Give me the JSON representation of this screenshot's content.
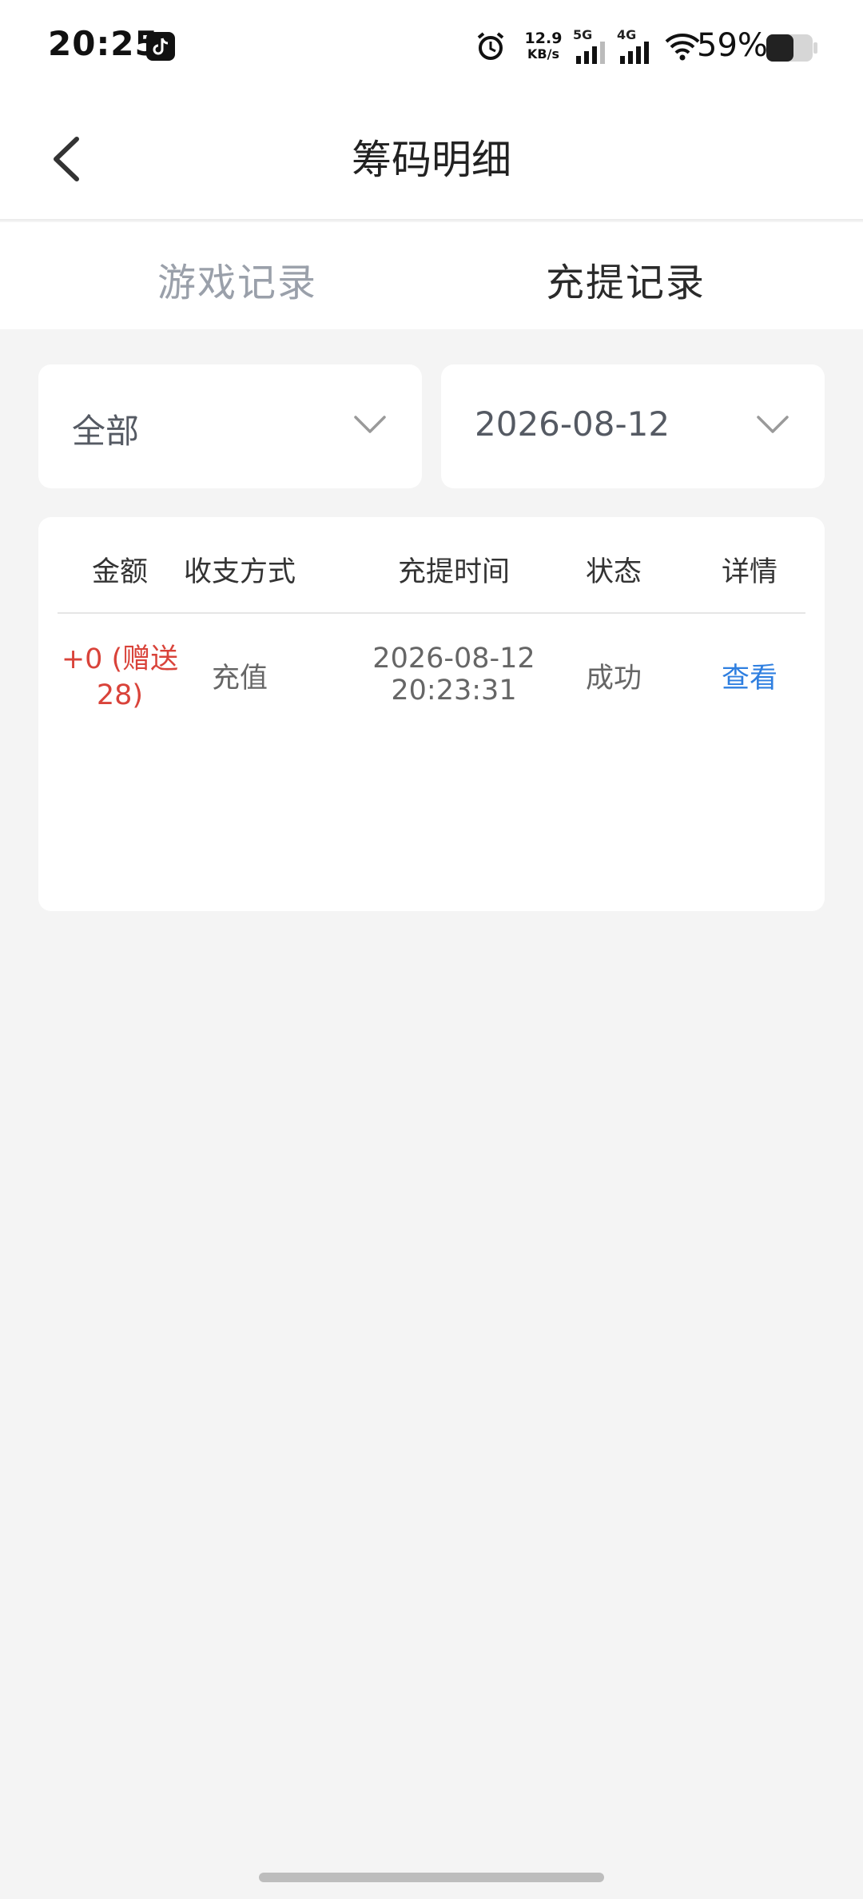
{
  "status_bar": {
    "time": "20:25",
    "net_speed_value": "12.9",
    "net_speed_unit": "KB/s",
    "signal1_label": "5G",
    "signal2_label": "4G",
    "battery": "59%"
  },
  "header": {
    "title": "筹码明细"
  },
  "tabs": [
    {
      "label": "游戏记录"
    },
    {
      "label": "充提记录"
    }
  ],
  "filters": {
    "type": "全部",
    "date": "2026-08-12"
  },
  "table": {
    "columns": [
      "金额",
      "收支方式",
      "充提时间",
      "状态",
      "详情"
    ],
    "rows": [
      {
        "amount_line1": "+0 (赠送",
        "amount_line2": "28)",
        "method": "充值",
        "date": "2026-08-12",
        "time": "20:23:31",
        "status": "成功",
        "detail": "查看"
      }
    ]
  },
  "colors": {
    "amount": "#d9433a",
    "link": "#2f7fe0",
    "inactive_tab": "#9aa0aa",
    "background": "#f4f4f4"
  }
}
